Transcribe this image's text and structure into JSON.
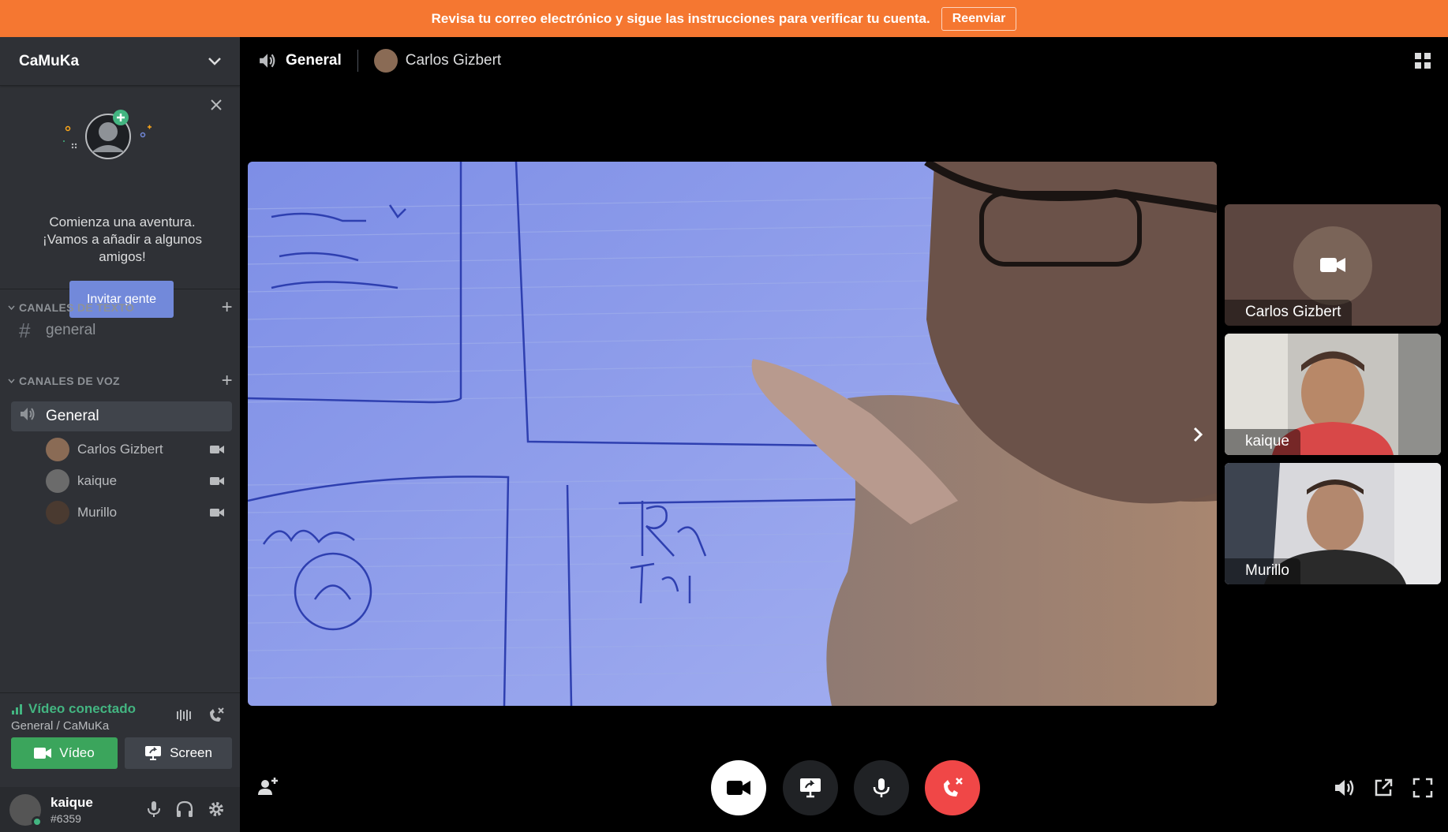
{
  "notice": {
    "message": "Revisa tu correo electrónico y sigue las instrucciones para verificar tu cuenta.",
    "button": "Reenviar"
  },
  "server": {
    "name": "CaMuKa"
  },
  "invite": {
    "text": "Comienza una aventura. ¡Vamos a añadir a algunos amigos!",
    "button": "Invitar gente"
  },
  "categories": {
    "text": "CANALES DE TEXTO",
    "voice": "CANALES DE VOZ"
  },
  "channels": {
    "text": [
      {
        "name": "general"
      }
    ],
    "voice": [
      {
        "name": "General"
      }
    ]
  },
  "members": [
    {
      "name": "Carlos Gizbert",
      "color": "#8a6b55"
    },
    {
      "name": "kaique",
      "color": "#6b6b6b"
    },
    {
      "name": "Murillo",
      "color": "#4a3a30"
    }
  ],
  "voice_panel": {
    "status": "Vídeo conectado",
    "location": "General / CaMuKa",
    "video_button": "Vídeo",
    "screen_button": "Screen"
  },
  "user": {
    "name": "kaique",
    "tag": "#6359"
  },
  "call": {
    "channel": "General",
    "header_user": "Carlos Gizbert"
  },
  "participants": [
    {
      "name": "Carlos Gizbert",
      "video": false
    },
    {
      "name": "kaique",
      "video": true
    },
    {
      "name": "Murillo",
      "video": true
    }
  ],
  "colors": {
    "accent": "#7289da",
    "green": "#43b581",
    "banner": "#f57731",
    "danger": "#f04747"
  }
}
